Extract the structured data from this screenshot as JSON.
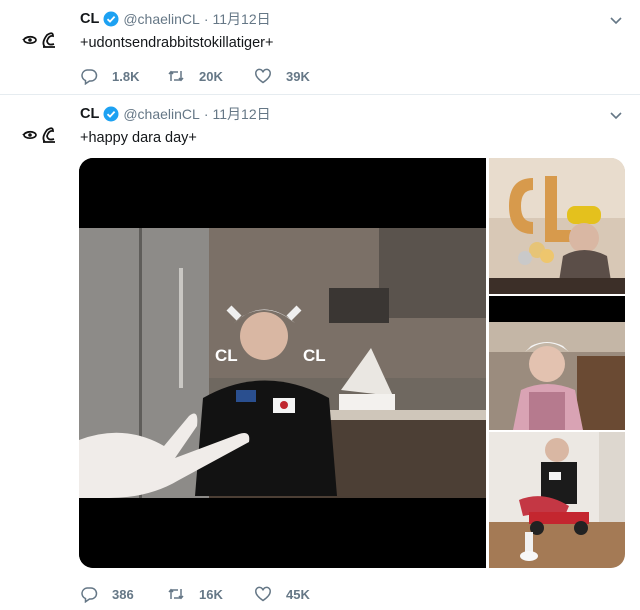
{
  "tweets": [
    {
      "name": "CL",
      "handle": "@chaelinCL",
      "separator": "·",
      "date": "11月12日",
      "text": "+udontsendrabbitstokillatiger+",
      "replies": "1.8K",
      "retweets": "20K",
      "likes": "39K"
    },
    {
      "name": "CL",
      "handle": "@chaelinCL",
      "separator": "·",
      "date": "11月12日",
      "text": "+happy dara day+",
      "replies": "386",
      "retweets": "16K",
      "likes": "45K",
      "media": [
        {
          "label": "CL"
        },
        {
          "label": "CL"
        }
      ]
    }
  ],
  "icons": {
    "verified": "verified-badge-icon",
    "caret": "chevron-down-icon",
    "reply": "reply-icon",
    "retweet": "retweet-icon",
    "like": "heart-icon"
  },
  "colors": {
    "accent": "#1da1f2",
    "muted": "#657786",
    "text": "#14171a"
  }
}
